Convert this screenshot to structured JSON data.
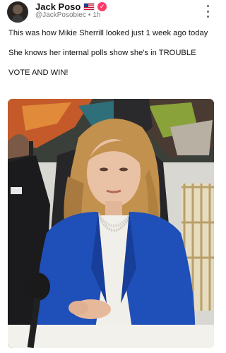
{
  "post": {
    "author": {
      "display_name": "Jack Poso",
      "flag_icon": "us-flag-icon",
      "verified_icon": "verified-badge-icon",
      "handle": "@JackPosobiec",
      "separator": "•",
      "time": "1h"
    },
    "menu_icon": "more-vertical-icon",
    "text_lines": [
      "This was how Mikie Sherrill looked just 1 week ago today",
      "She knows her internal polls show she's in TROUBLE",
      "VOTE AND WIN!"
    ],
    "media": {
      "type": "photo"
    }
  },
  "colors": {
    "verified": "#ff3b6b",
    "blazer": "#1f4fb8",
    "wall": "#d6d4cf"
  }
}
